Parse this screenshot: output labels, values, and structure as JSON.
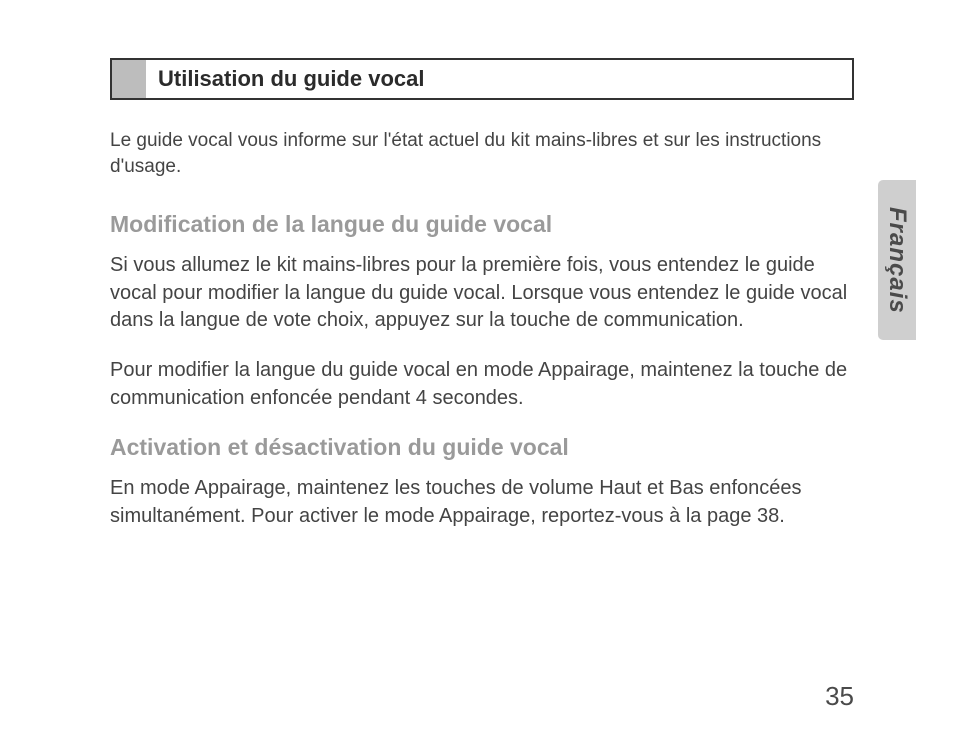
{
  "section_title": "Utilisation du guide vocal",
  "intro": "Le guide vocal vous informe sur l'état actuel du kit mains-libres et sur les instructions d'usage.",
  "sub1": {
    "heading": "Modification de la langue du guide vocal",
    "p1": "Si vous allumez le kit mains-libres pour la première fois, vous entendez le guide vocal pour modifier la langue du guide vocal. Lorsque vous entendez le guide vocal dans la langue de vote choix, appuyez sur la touche de communication.",
    "p2": "Pour modifier la langue du guide vocal en mode Appairage, maintenez la touche de communication enfoncée pendant 4 secondes."
  },
  "sub2": {
    "heading": "Activation et désactivation du guide vocal",
    "p1": "En mode Appairage, maintenez les touches de volume Haut et Bas enfoncées simultanément. Pour activer le mode Appairage, reportez-vous à la page 38."
  },
  "side_tab": "Français",
  "page_number": "35"
}
